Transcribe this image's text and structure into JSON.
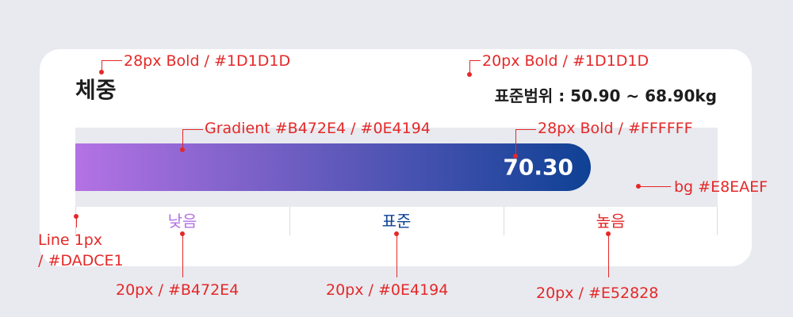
{
  "widget": {
    "title": "체중",
    "normal_range": "표준범위 : 50.90 ~ 68.90kg",
    "value": "70.30",
    "value_fraction": 0.803,
    "scale_labels": [
      {
        "text": "낮음",
        "color": "#B472E4"
      },
      {
        "text": "표준",
        "color": "#0E4194"
      },
      {
        "text": "높음",
        "color": "#E52828"
      }
    ]
  },
  "annotations": {
    "title_spec": "28px Bold / #1D1D1D",
    "range_spec": "20px Bold / #1D1D1D",
    "gradient_spec": "Gradient #B472E4 / #0E4194",
    "value_spec": "28px Bold / #FFFFFF",
    "bg_spec": "bg #E8EAEF",
    "line_spec_1": "Line 1px",
    "line_spec_2": "/ #DADCE1",
    "low_spec": "20px / #B472E4",
    "normal_spec": "20px / #0E4194",
    "high_spec": "20px / #E52828"
  },
  "colors": {
    "background": "#E8EAEF",
    "card": "#FFFFFF",
    "text_dark": "#1D1D1D",
    "gradient_start": "#B472E4",
    "gradient_end": "#0E4194",
    "divider": "#DADCE1",
    "annotation": "#E52828"
  }
}
